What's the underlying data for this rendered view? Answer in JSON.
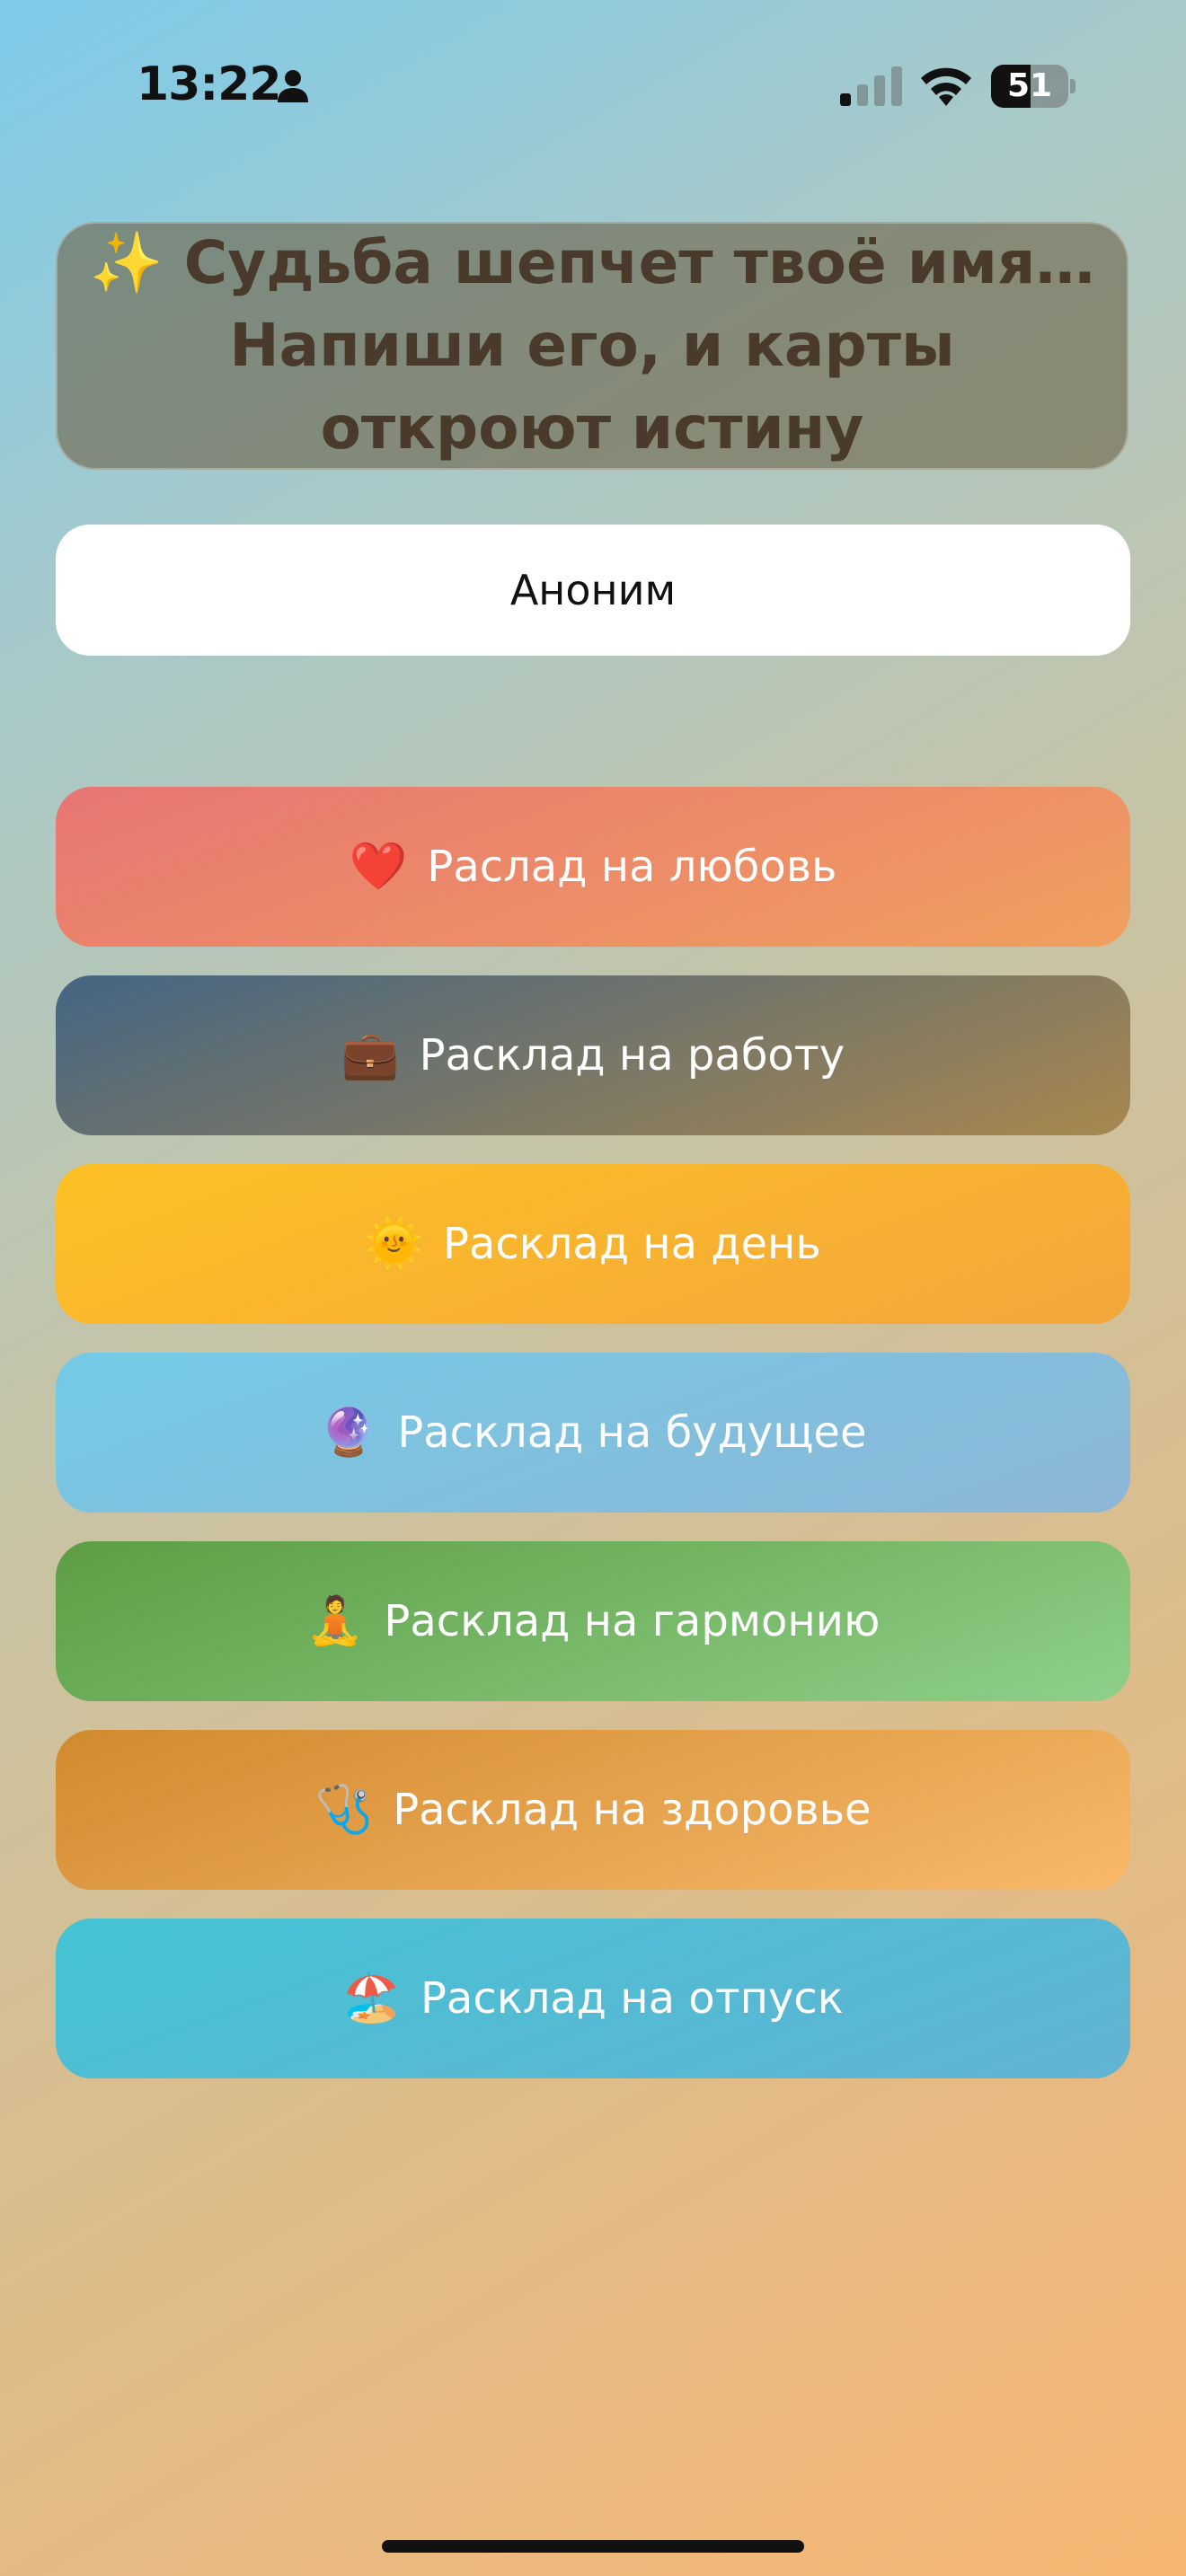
{
  "status_bar": {
    "time": "13:22",
    "battery": "51",
    "battery_level": 0.51,
    "icons": [
      "person-icon",
      "cellular-signal-icon",
      "wifi-icon",
      "battery-icon"
    ]
  },
  "header": {
    "line1": "✨ Судьба шепчет твоё имя…",
    "line2": "Напиши его, и карты откроют истину"
  },
  "name_input": {
    "value": "Аноним"
  },
  "spreads": [
    {
      "label": "Раслад на любовь",
      "icon": "heart-icon",
      "emoji": "❤️",
      "colors": [
        "#e87573",
        "#f0a05e"
      ]
    },
    {
      "label": "Расклад на работу",
      "icon": "briefcase-icon",
      "emoji": "💼",
      "colors": [
        "#456582",
        "#a8874e"
      ]
    },
    {
      "label": "Расклад на день",
      "icon": "sun-icon",
      "emoji": "🌞",
      "colors": [
        "#fcc125",
        "#f4a63a"
      ]
    },
    {
      "label": "Расклад на будущее",
      "icon": "crystal-ball-icon",
      "emoji": "🔮",
      "colors": [
        "#73cbe6",
        "#8db6d6"
      ]
    },
    {
      "label": "Расклад на гармонию",
      "icon": "meditation-icon",
      "emoji": "🧘",
      "colors": [
        "#5c9d43",
        "#8fd08a"
      ]
    },
    {
      "label": "Расклад на здоровье",
      "icon": "stethoscope-icon",
      "emoji": "🩺",
      "colors": [
        "#d18a2e",
        "#f9b96a"
      ]
    },
    {
      "label": "Расклад на отпуск",
      "icon": "beach-umbrella-icon",
      "emoji": "🏖️",
      "colors": [
        "#44c3d3",
        "#62b3d3"
      ]
    }
  ]
}
